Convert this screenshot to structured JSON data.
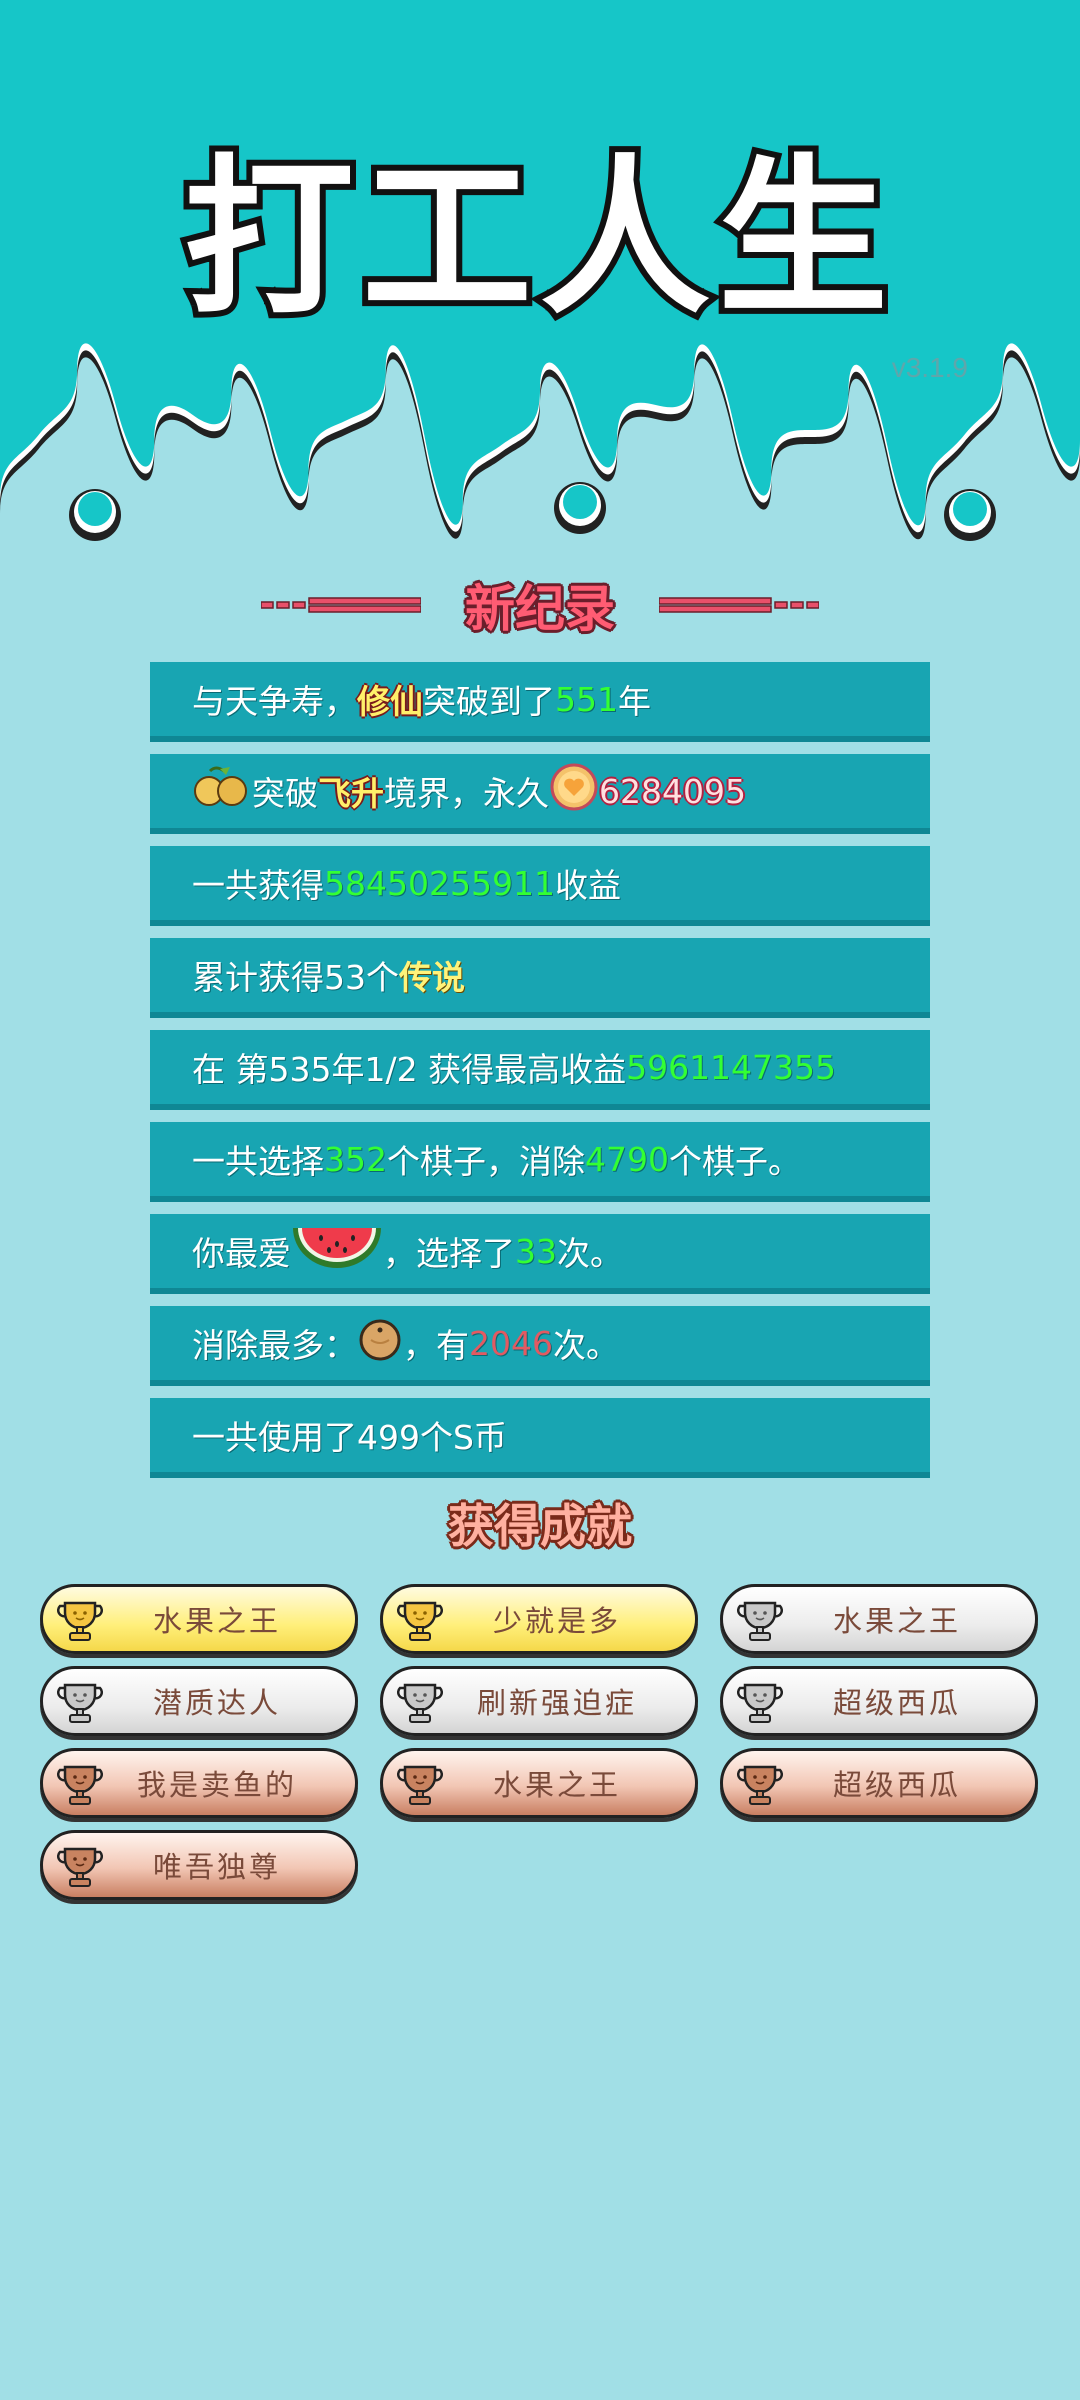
{
  "game": {
    "title": "打工人生",
    "version": "v3.1.9"
  },
  "record_section": {
    "heading": "新纪录"
  },
  "stats": [
    {
      "parts": [
        {
          "t": "与天争寿，"
        },
        {
          "t": "修仙",
          "s": "gold"
        },
        {
          "t": "突破到了"
        },
        {
          "t": "551",
          "s": "green"
        },
        {
          "t": "年"
        }
      ]
    },
    {
      "parts": [
        {
          "icon": "pear-icon"
        },
        {
          "t": "突破"
        },
        {
          "t": "飞升",
          "s": "gold"
        },
        {
          "t": "境界，永久"
        },
        {
          "icon": "heart-coin-icon"
        },
        {
          "t": "6284095",
          "s": "pink-num"
        }
      ]
    },
    {
      "parts": [
        {
          "t": "一共获得"
        },
        {
          "t": "58450255911",
          "s": "green"
        },
        {
          "t": "收益"
        }
      ]
    },
    {
      "parts": [
        {
          "t": "累计获得53个 "
        },
        {
          "t": "传说",
          "s": "gold-plain"
        }
      ]
    },
    {
      "parts": [
        {
          "t": "在  第535年1/2 获得最高收益"
        },
        {
          "t": "5961147355",
          "s": "green"
        }
      ]
    },
    {
      "parts": [
        {
          "t": "一共选择"
        },
        {
          "t": "352",
          "s": "green"
        },
        {
          "t": "个棋子，消除"
        },
        {
          "t": "4790",
          "s": "green"
        },
        {
          "t": "个棋子。"
        }
      ]
    },
    {
      "parts": [
        {
          "t": "你最爱"
        },
        {
          "icon": "watermelon-icon"
        },
        {
          "t": "，选择了"
        },
        {
          "t": "33",
          "s": "green"
        },
        {
          "t": "次。"
        }
      ]
    },
    {
      "parts": [
        {
          "t": "消除最多："
        },
        {
          "icon": "orange-icon"
        },
        {
          "t": "，有"
        },
        {
          "t": "2046",
          "s": "red"
        },
        {
          "t": "次。"
        }
      ]
    },
    {
      "parts": [
        {
          "t": "一共使用了499个S币"
        }
      ]
    }
  ],
  "achievements": {
    "heading": "获得成就",
    "items": [
      {
        "label": "水果之王",
        "tier": "gold"
      },
      {
        "label": "少就是多",
        "tier": "gold"
      },
      {
        "label": "水果之王",
        "tier": "silver"
      },
      {
        "label": "潜质达人",
        "tier": "silver"
      },
      {
        "label": "刷新强迫症",
        "tier": "silver"
      },
      {
        "label": "超级西瓜",
        "tier": "silver"
      },
      {
        "label": "我是卖鱼的",
        "tier": "bronze"
      },
      {
        "label": "水果之王",
        "tier": "bronze"
      },
      {
        "label": "超级西瓜",
        "tier": "bronze"
      },
      {
        "label": "唯吾独尊",
        "tier": "bronze"
      }
    ]
  },
  "colors": {
    "header_bg": "#16c6c8",
    "page_bg": "#a1dfe6",
    "row_bg": "#18a5b2",
    "highlight_green": "#33ff33",
    "highlight_red": "#e25a62"
  }
}
